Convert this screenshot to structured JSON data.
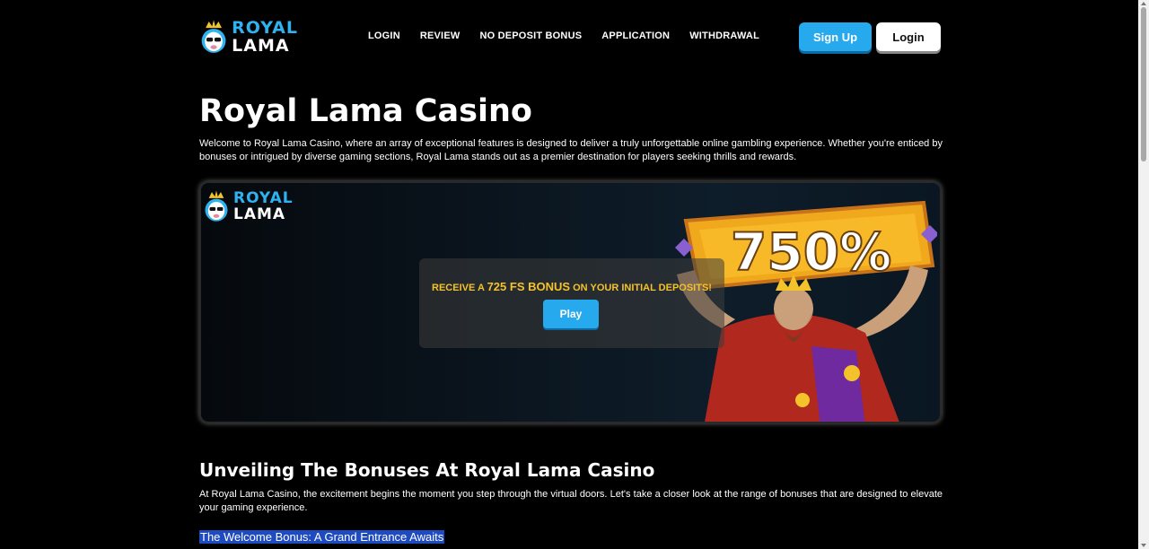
{
  "header": {
    "logo_line1": "ROYAL",
    "logo_line2": "LAMA",
    "nav": [
      "LOGIN",
      "REVIEW",
      "NO DEPOSIT BONUS",
      "APPLICATION",
      "WITHDRAWAL"
    ],
    "signup_label": "Sign Up",
    "login_label": "Login"
  },
  "main": {
    "title": "Royal Lama Casino",
    "intro": "Welcome to Royal Lama Casino, where an array of exceptional features is designed to deliver a truly unforgettable online gambling experience. Whether you're enticed by bonuses or intrigued by diverse gaming sections, Royal Lama stands out as a premier destination for players seeking thrills and rewards."
  },
  "banner": {
    "logo_line1": "ROYAL",
    "logo_line2": "LAMA",
    "promo_prefix": "RECEIVE A",
    "promo_highlight": "725 FS BONUS",
    "promo_suffix": "ON YOUR INITIAL DEPOSITS!",
    "play_label": "Play",
    "plaque_text": "750%"
  },
  "section": {
    "title": "Unveiling The Bonuses At Royal Lama Casino",
    "text": "At Royal Lama Casino, the excitement begins the moment you step through the virtual doors. Let's take a closer look at the range of bonuses that are designed to elevate your gaming experience.",
    "subhead": "The Welcome Bonus: A Grand Entrance Awaits"
  },
  "colors": {
    "accent": "#27a9ee",
    "gold": "#f4c22b",
    "background": "#000000",
    "highlight": "#1e4bbf"
  },
  "icons": {
    "logo": "llama-crown-icon"
  }
}
